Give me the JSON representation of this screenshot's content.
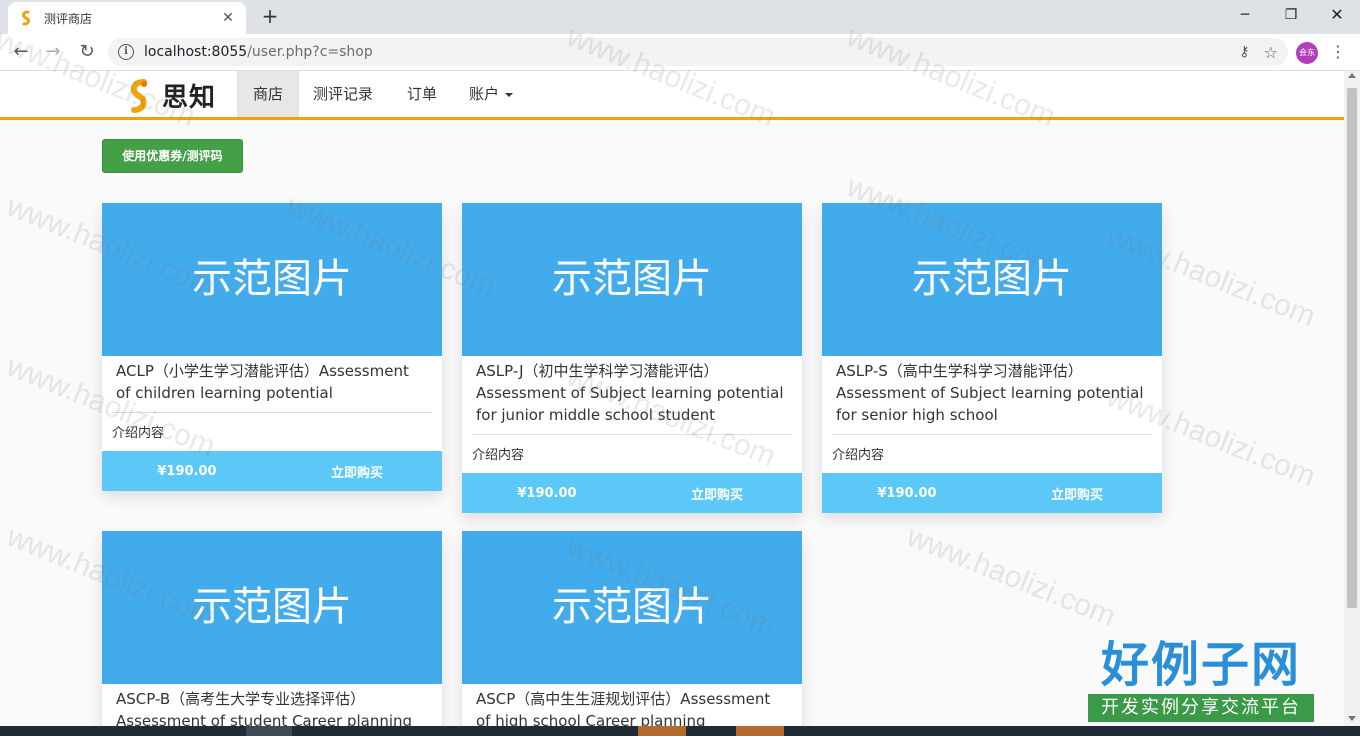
{
  "browser": {
    "tab_title": "测评商店",
    "url_host": "localhost:8055",
    "url_path": "/user.php?c=shop",
    "avatar_text": "会东",
    "icons": {
      "favicon": "orange-s-logo",
      "close": "close-icon",
      "new_tab": "plus-icon",
      "back": "arrow-left-icon",
      "forward": "arrow-right-icon",
      "reload": "reload-icon",
      "info": "info-icon",
      "key": "key-icon",
      "star": "star-icon",
      "menu": "kebab-menu-icon"
    }
  },
  "navbar": {
    "brand": "思知",
    "items": [
      {
        "label": "商店",
        "active": true
      },
      {
        "label": "测评记录"
      },
      {
        "label": "订单"
      },
      {
        "label": "账户",
        "dropdown": true
      }
    ],
    "accent_color": "#f0a30a"
  },
  "coupon_button": "使用优惠券/测评码",
  "products": [
    {
      "image_text": "示范图片",
      "title": "ACLP（小学生学习潜能评估）Assessment of children learning potential",
      "description": "介绍内容",
      "price": "¥190.00",
      "buy_label": "立即购买"
    },
    {
      "image_text": "示范图片",
      "title": "ASLP-J（初中生学科学习潜能评估）Assessment of Subject learning potential for junior middle school student",
      "description": "介绍内容",
      "price": "¥190.00",
      "buy_label": "立即购买"
    },
    {
      "image_text": "示范图片",
      "title": "ASLP-S（高中生学科学习潜能评估）Assessment of Subject learning potential for senior high school",
      "description": "介绍内容",
      "price": "¥190.00",
      "buy_label": "立即购买"
    },
    {
      "image_text": "示范图片",
      "title": "ASCP-B（高考生大学专业选择评估）Assessment of student Career planning"
    },
    {
      "image_text": "示范图片",
      "title": "ASCP（高中生生涯规划评估）Assessment of high school Career planning"
    }
  ],
  "colors": {
    "card_image": "#42abec",
    "card_footer": "#5bc8f7",
    "coupon_button": "#43a047"
  },
  "watermark": {
    "text": "www.haolizi.com",
    "logo_title": "好例子网",
    "logo_subtitle": "开发实例分享交流平台"
  }
}
